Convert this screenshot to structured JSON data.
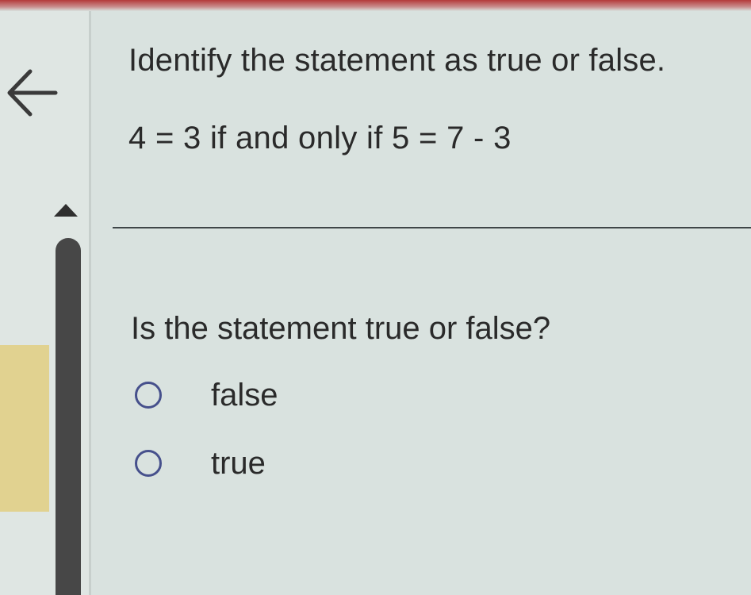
{
  "header": {
    "prompt": "Identify the statement as true or false.",
    "statement": "4 = 3 if and only if 5 = 7  -  3"
  },
  "question": {
    "text": "Is the statement true or false?",
    "options": [
      {
        "label": "false",
        "selected": false
      },
      {
        "label": "true",
        "selected": false
      }
    ]
  },
  "icons": {
    "back": "back-arrow-icon",
    "scroll_up": "triangle-up-icon"
  },
  "colors": {
    "radio_border": "#46508c",
    "scrollbar": "#474747",
    "accent_top": "#b43a3a"
  }
}
